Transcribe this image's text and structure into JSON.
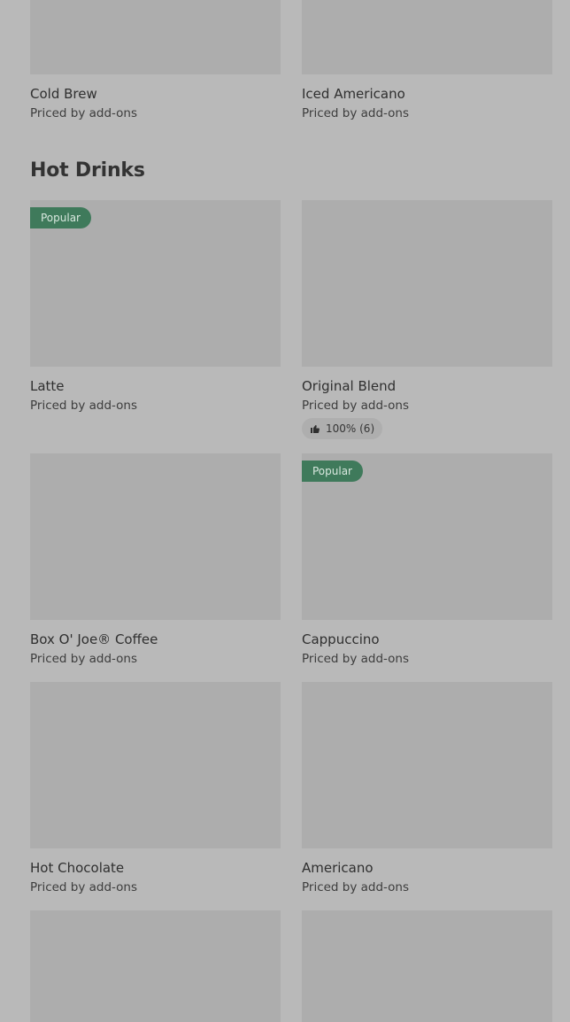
{
  "top_row": [
    {
      "name": "Cold Brew",
      "price": "Priced by add-ons"
    },
    {
      "name": "Iced Americano",
      "price": "Priced by add-ons"
    }
  ],
  "hot_drinks": {
    "title": "Hot Drinks",
    "items": [
      {
        "name": "Latte",
        "price": "Priced by add-ons",
        "badge": "Popular"
      },
      {
        "name": "Original Blend",
        "price": "Priced by add-ons",
        "rating": "100% (6)"
      },
      {
        "name": "Box O' Joe® Coffee",
        "price": "Priced by add-ons"
      },
      {
        "name": "Cappuccino",
        "price": "Priced by add-ons",
        "badge": "Popular"
      },
      {
        "name": "Hot Chocolate",
        "price": "Priced by add-ons"
      },
      {
        "name": "Americano",
        "price": "Priced by add-ons"
      }
    ]
  },
  "icons": {
    "rating": "thumbs-up-icon"
  },
  "colors": {
    "background": "#b9b9b9",
    "image_placeholder": "#adadad",
    "badge": "#3f7a5b"
  }
}
